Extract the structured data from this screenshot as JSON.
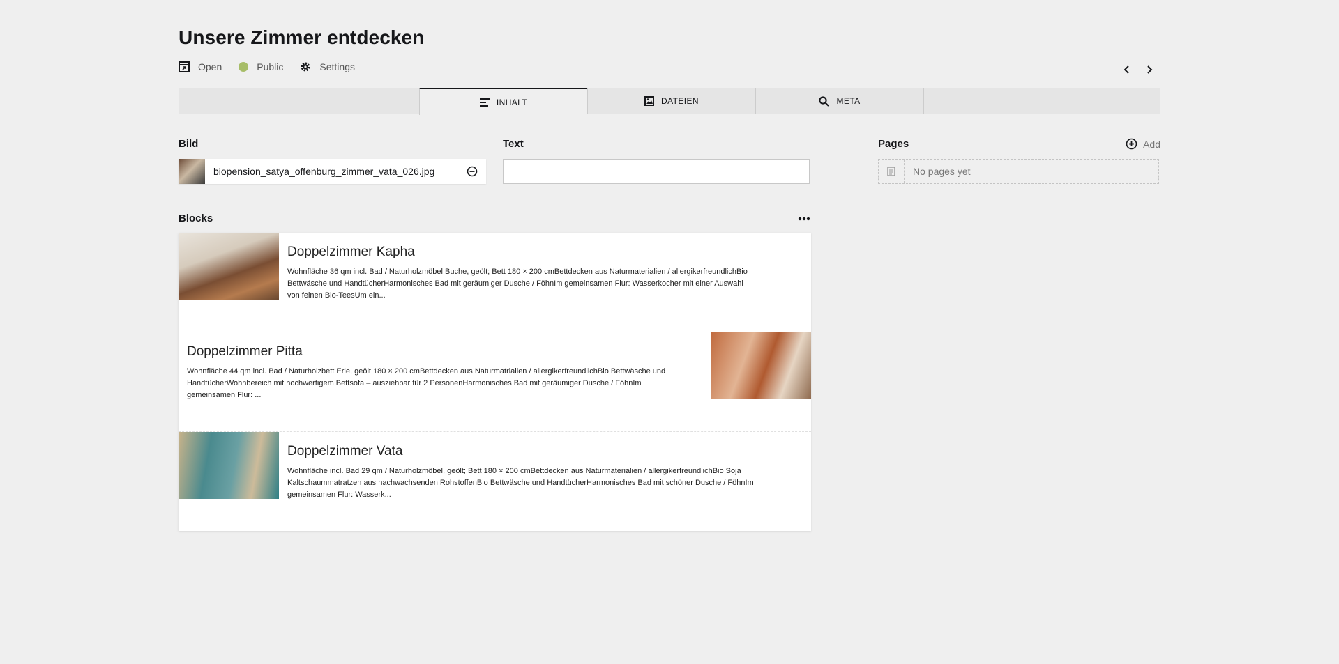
{
  "header": {
    "title": "Unsere Zimmer entdecken",
    "options": [
      {
        "label": "Open",
        "icon": "open-icon"
      },
      {
        "label": "Public",
        "icon": "status-dot",
        "color": "#a7bd68"
      },
      {
        "label": "Settings",
        "icon": "gear-icon"
      }
    ]
  },
  "tabs": [
    {
      "label": "INHALT",
      "icon": "text-lines-icon",
      "active": true
    },
    {
      "label": "DATEIEN",
      "icon": "image-icon",
      "active": false
    },
    {
      "label": "META",
      "icon": "search-icon",
      "active": false
    }
  ],
  "fields": {
    "bild": {
      "label": "Bild",
      "filename": "biopension_satya_offenburg_zimmer_vata_026.jpg"
    },
    "text": {
      "label": "Text",
      "value": ""
    },
    "pages": {
      "label": "Pages",
      "add_label": "Add",
      "empty_text": "No pages yet"
    },
    "blocks": {
      "label": "Blocks"
    }
  },
  "blocks": [
    {
      "title": "Doppelzimmer Kapha",
      "text": "Wohnfläche 36 qm incl. Bad / Naturholzmöbel Buche, geölt; Bett 180 × 200 cmBettdecken aus Naturmaterialien / allergikerfreundlichBio Bettwäsche und HandtücherHarmonisches Bad mit geräumiger Dusche / FöhnIm gemeinsamen Flur: Wasserkocher mit einer Auswahl von feinen Bio-TeesUm ein..."
    },
    {
      "title": "Doppelzimmer Pitta",
      "text": "Wohnfläche 44 qm incl. Bad / Naturholzbett Erle, geölt 180 × 200 cmBettdecken aus Naturmatrialien / allergikerfreundlichBio Bettwäsche und HandtücherWohnbereich mit hochwertigem Bettsofa – ausziehbar für 2 PersonenHarmonisches Bad mit geräumiger Dusche / FöhnIm gemeinsamen Flur: ..."
    },
    {
      "title": "Doppelzimmer Vata",
      "text": "Wohnfläche incl. Bad 29 qm / Naturholzmöbel, geölt; Bett 180 × 200 cmBettdecken aus Naturmaterialien / allergikerfreundlichBio Soja Kaltschaummatratzen aus nachwachsenden RohstoffenBio Bettwäsche und HandtücherHarmonisches Bad mit schöner Dusche / FöhnIm gemeinsamen Flur: Wasserk..."
    }
  ]
}
